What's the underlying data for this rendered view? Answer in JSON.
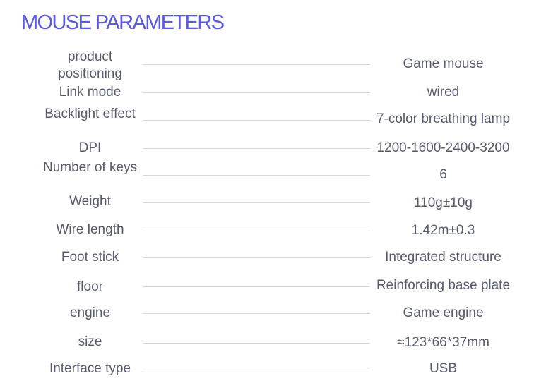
{
  "title": "MOUSE PARAMETERS",
  "params": [
    {
      "label": "product positioning",
      "value": "Game mouse"
    },
    {
      "label": "Link mode",
      "value": "wired"
    },
    {
      "label": "Backlight effect",
      "value": "7-color breathing lamp"
    },
    {
      "label": "DPI",
      "value": "1200-1600-2400-3200"
    },
    {
      "label": "Number of keys",
      "value": "6"
    },
    {
      "label": "Weight",
      "value": "110g±10g"
    },
    {
      "label": "Wire length",
      "value": "1.42m±0.3"
    },
    {
      "label": "Foot stick",
      "value": "Integrated structure"
    },
    {
      "label": "floor",
      "value": "Reinforcing base plate"
    },
    {
      "label": "engine",
      "value": "Game engine"
    },
    {
      "label": "size",
      "value": "≈123*66*37mm"
    },
    {
      "label": "Interface type",
      "value": "USB"
    }
  ]
}
